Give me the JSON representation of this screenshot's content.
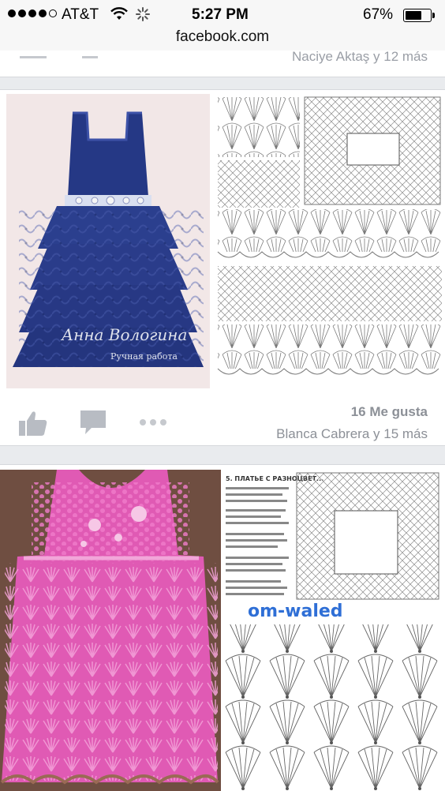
{
  "status_bar": {
    "carrier": "AT&T",
    "time": "5:27 PM",
    "battery": "67%",
    "battery_level": 0.67
  },
  "url_bar": {
    "domain": "facebook.com"
  },
  "prev_post": {
    "reactors": "Naciye Aktaş y 12 más"
  },
  "posts": [
    {
      "photo_caption": "Анна Вологина",
      "photo_caption_sub": "Ручная работа",
      "likes": "16 Me gusta",
      "reactors": "Blanca Cabrera y 15 más"
    },
    {
      "diagram_heading": "5. ПЛАТЬЕ С РАЗНОЦВЕТ...",
      "watermark": "om-waled"
    }
  ],
  "icons": [
    "like-icon",
    "comment-icon",
    "more-icon",
    "wifi-icon",
    "activity-spinner-icon",
    "battery-icon"
  ],
  "colors": {
    "dress1": "#2b3f8e",
    "dress2": "#e05ab4",
    "meta_text": "#8c9097",
    "icon_gray": "#b8bcc3"
  }
}
